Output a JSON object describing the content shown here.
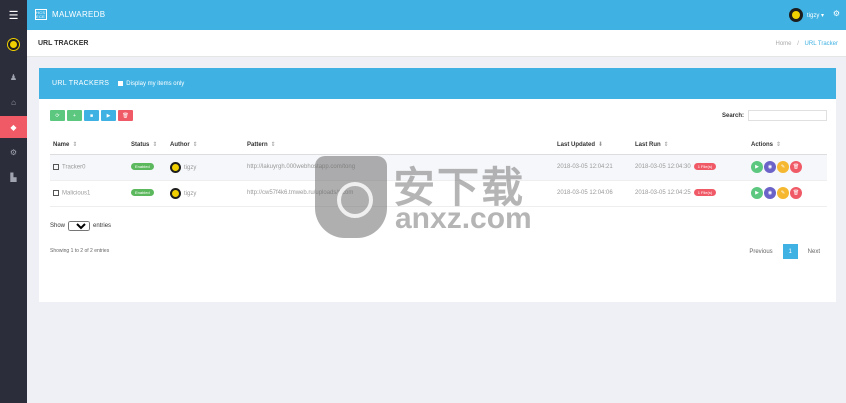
{
  "app": {
    "brand": "MALWAREDB",
    "brand_icon_text": "HCS ECE",
    "user_name": "tigzy ▾"
  },
  "sidebar": {
    "menu_icon": "☰",
    "items": [
      {
        "icon": "user-icon",
        "glyph": "♟"
      },
      {
        "icon": "home-icon",
        "glyph": "⌂"
      },
      {
        "icon": "tracker-icon",
        "glyph": "◆"
      },
      {
        "icon": "cog-icon",
        "glyph": "⚙"
      },
      {
        "icon": "chart-icon",
        "glyph": "▙"
      }
    ]
  },
  "header": {
    "title": "URL TRACKER",
    "breadcrumb": {
      "home": "Home",
      "sep": "/",
      "current": "URL Tracker"
    }
  },
  "card": {
    "title": "URL TRACKERS",
    "checkbox_label": "Display my items only"
  },
  "toolbar": {
    "buttons": [
      {
        "icon": "refresh-icon",
        "glyph": "⟳",
        "color": "#5cc77f"
      },
      {
        "icon": "plus-icon",
        "glyph": "+",
        "color": "#5cc77f"
      },
      {
        "icon": "stop-icon",
        "glyph": "■",
        "color": "#3fb1e3"
      },
      {
        "icon": "play-icon",
        "glyph": "▶",
        "color": "#3fb1e3"
      },
      {
        "icon": "trash-icon",
        "glyph": "🗑",
        "color": "#f05a66"
      }
    ]
  },
  "search": {
    "label": "Search:",
    "value": ""
  },
  "table": {
    "columns": {
      "name": "Name",
      "status": "Status",
      "author": "Author",
      "pattern": "Pattern",
      "updated": "Last Updated",
      "last_run": "Last Run",
      "actions": "Actions",
      "sort_glyph": "⇕",
      "sort_active": "⬇"
    },
    "rows": [
      {
        "name": "Tracker0",
        "status": "Enabled",
        "author": "tigzy",
        "pattern": "http://lakuyrgh.000webhostapp.com/tong",
        "updated": "2018-03-05 12:04:21",
        "last_run": "2018-03-05 12:04:30",
        "run_badge": "1 File(s)"
      },
      {
        "name": "Malicious1",
        "status": "Enabled",
        "author": "tigzy",
        "pattern": "http://cw57f4k6.tmweb.ru/uploads/*.com",
        "updated": "2018-03-05 12:04:06",
        "last_run": "2018-03-05 12:04:25",
        "run_badge": "1 File(s)"
      }
    ]
  },
  "actions": [
    {
      "icon": "play-action-icon",
      "glyph": "▶",
      "color": "#5cc77f"
    },
    {
      "icon": "view-action-icon",
      "glyph": "◉",
      "color": "#6c63c9"
    },
    {
      "icon": "edit-action-icon",
      "glyph": "✎",
      "color": "#f5b830"
    },
    {
      "icon": "delete-action-icon",
      "glyph": "🗑",
      "color": "#f05a66"
    }
  ],
  "length": {
    "show": "Show",
    "value": "25",
    "entries": "entries"
  },
  "info": "Showing 1 to 2 of 2 entries",
  "pager": {
    "previous": "Previous",
    "current": "1",
    "next": "Next"
  },
  "watermark": {
    "cn": "安下载",
    "url": "anxz.com"
  }
}
